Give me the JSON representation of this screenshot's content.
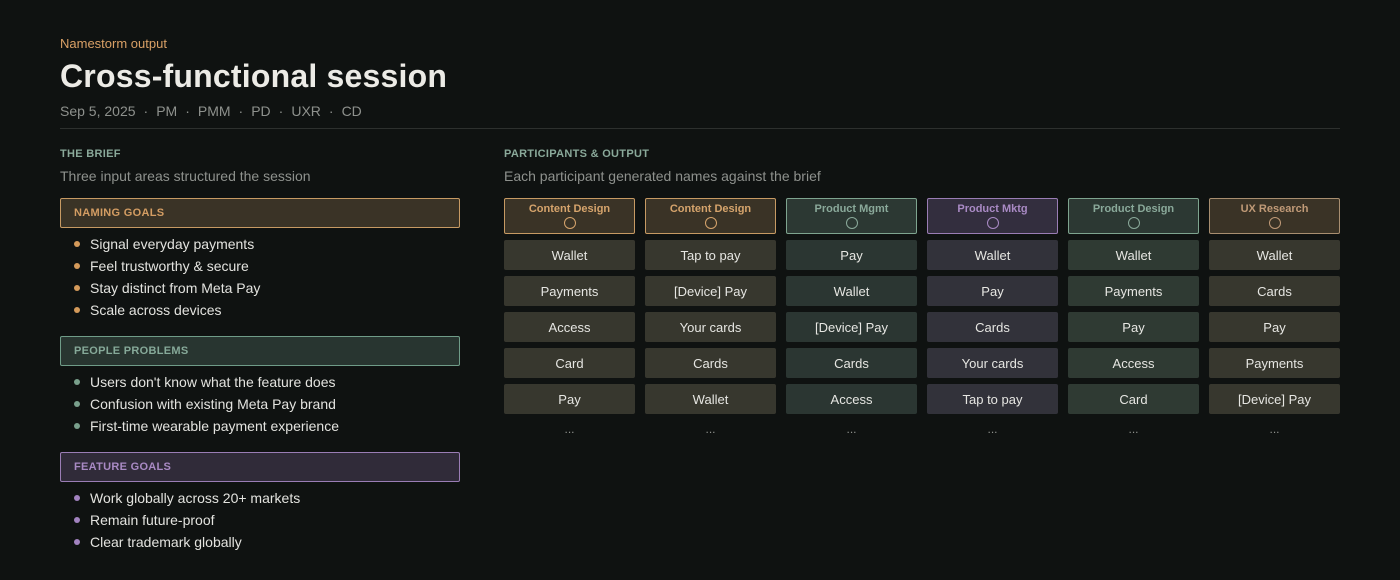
{
  "header": {
    "eyebrow": "Namestorm output",
    "title": "Cross-functional session",
    "date": "Sep 5, 2025",
    "roles": [
      "PM",
      "PMM",
      "PD",
      "UXR",
      "CD"
    ]
  },
  "brief": {
    "label": "THE BRIEF",
    "subtitle": "Three input areas structured the session",
    "naming_goals": {
      "label": "NAMING GOALS",
      "items": [
        "Signal everyday payments",
        "Feel trustworthy & secure",
        "Stay distinct from Meta Pay",
        "Scale across devices"
      ]
    },
    "people_problems": {
      "label": "PEOPLE PROBLEMS",
      "items": [
        "Users don't know what the feature does",
        "Confusion with existing Meta Pay brand",
        "First-time wearable payment experience"
      ]
    },
    "feature_goals": {
      "label": "FEATURE GOALS",
      "items": [
        "Work globally across 20+ markets",
        "Remain future-proof",
        "Clear trademark globally"
      ]
    }
  },
  "participants": {
    "label": "PARTICIPANTS & OUTPUT",
    "subtitle": "Each participant generated names against the brief",
    "ellipsis": "...",
    "columns": [
      {
        "name": "Content Design",
        "names": [
          "Wallet",
          "Payments",
          "Access",
          "Card",
          "Pay"
        ]
      },
      {
        "name": "Content Design",
        "names": [
          "Tap to pay",
          "[Device] Pay",
          "Your cards",
          "Cards",
          "Wallet"
        ]
      },
      {
        "name": "Product Mgmt",
        "names": [
          "Pay",
          "Wallet",
          "[Device] Pay",
          "Cards",
          "Access"
        ]
      },
      {
        "name": "Product Mktg",
        "names": [
          "Wallet",
          "Pay",
          "Cards",
          "Your cards",
          "Tap to pay"
        ]
      },
      {
        "name": "Product Design",
        "names": [
          "Wallet",
          "Payments",
          "Pay",
          "Access",
          "Card"
        ]
      },
      {
        "name": "UX Research",
        "names": [
          "Wallet",
          "Cards",
          "Pay",
          "Payments",
          "[Device] Pay"
        ]
      }
    ]
  },
  "colors": {
    "background": "#0f1211",
    "naming": "#d49d63",
    "people": "#86a999",
    "feature": "#a98ac4"
  }
}
